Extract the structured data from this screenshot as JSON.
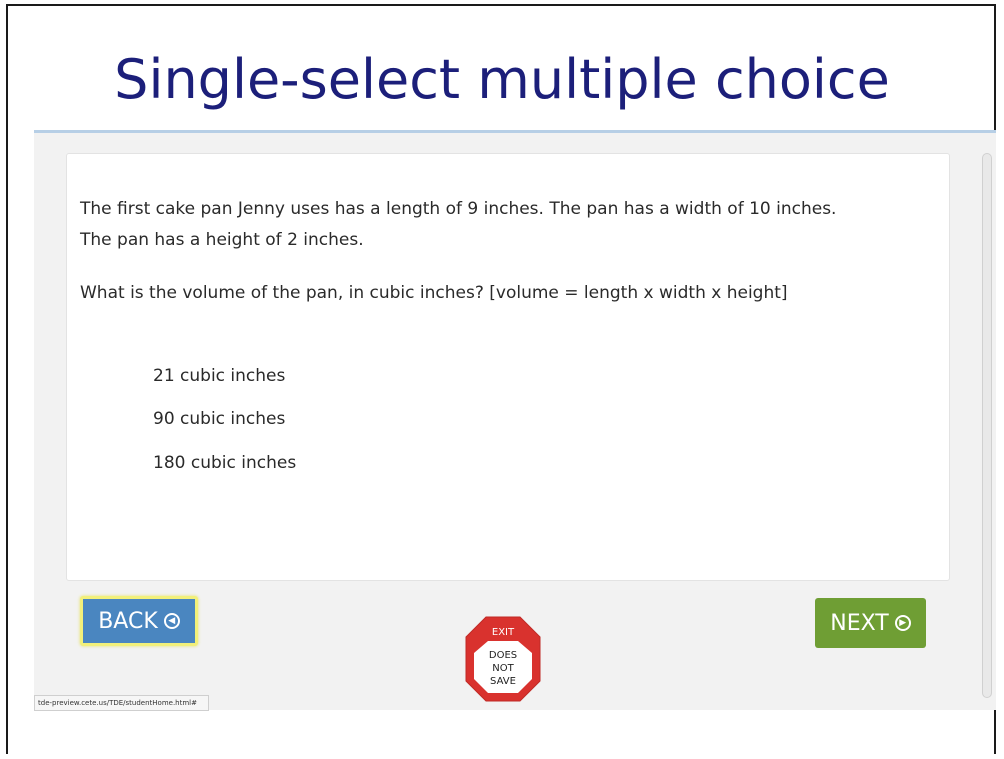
{
  "slide": {
    "title": "Single-select multiple choice"
  },
  "question": {
    "stem_line1": "The first cake pan Jenny uses has a length of 9 inches. The pan has a width of 10 inches.",
    "stem_line2": "The pan has a height of 2 inches.",
    "prompt": "What is the volume of the pan, in cubic inches? [volume = length x width x height]",
    "choices": [
      {
        "label": "21 cubic inches"
      },
      {
        "label": "90 cubic inches"
      },
      {
        "label": "180 cubic inches"
      }
    ]
  },
  "navigation": {
    "back_label": "BACK",
    "next_label": "NEXT",
    "back_icon": "arrow-left-circle-icon",
    "next_icon": "arrow-right-circle-icon"
  },
  "exit": {
    "exit_label": "EXIT",
    "does": "DOES",
    "not": "NOT",
    "save": "SAVE"
  },
  "status_bar": {
    "url": "tde-preview.cete.us/TDE/studentHome.html#"
  },
  "colors": {
    "title": "#1c1f7a",
    "back_button": "#4a86c0",
    "next_button": "#6f9e34",
    "exit_red": "#d9322e"
  }
}
